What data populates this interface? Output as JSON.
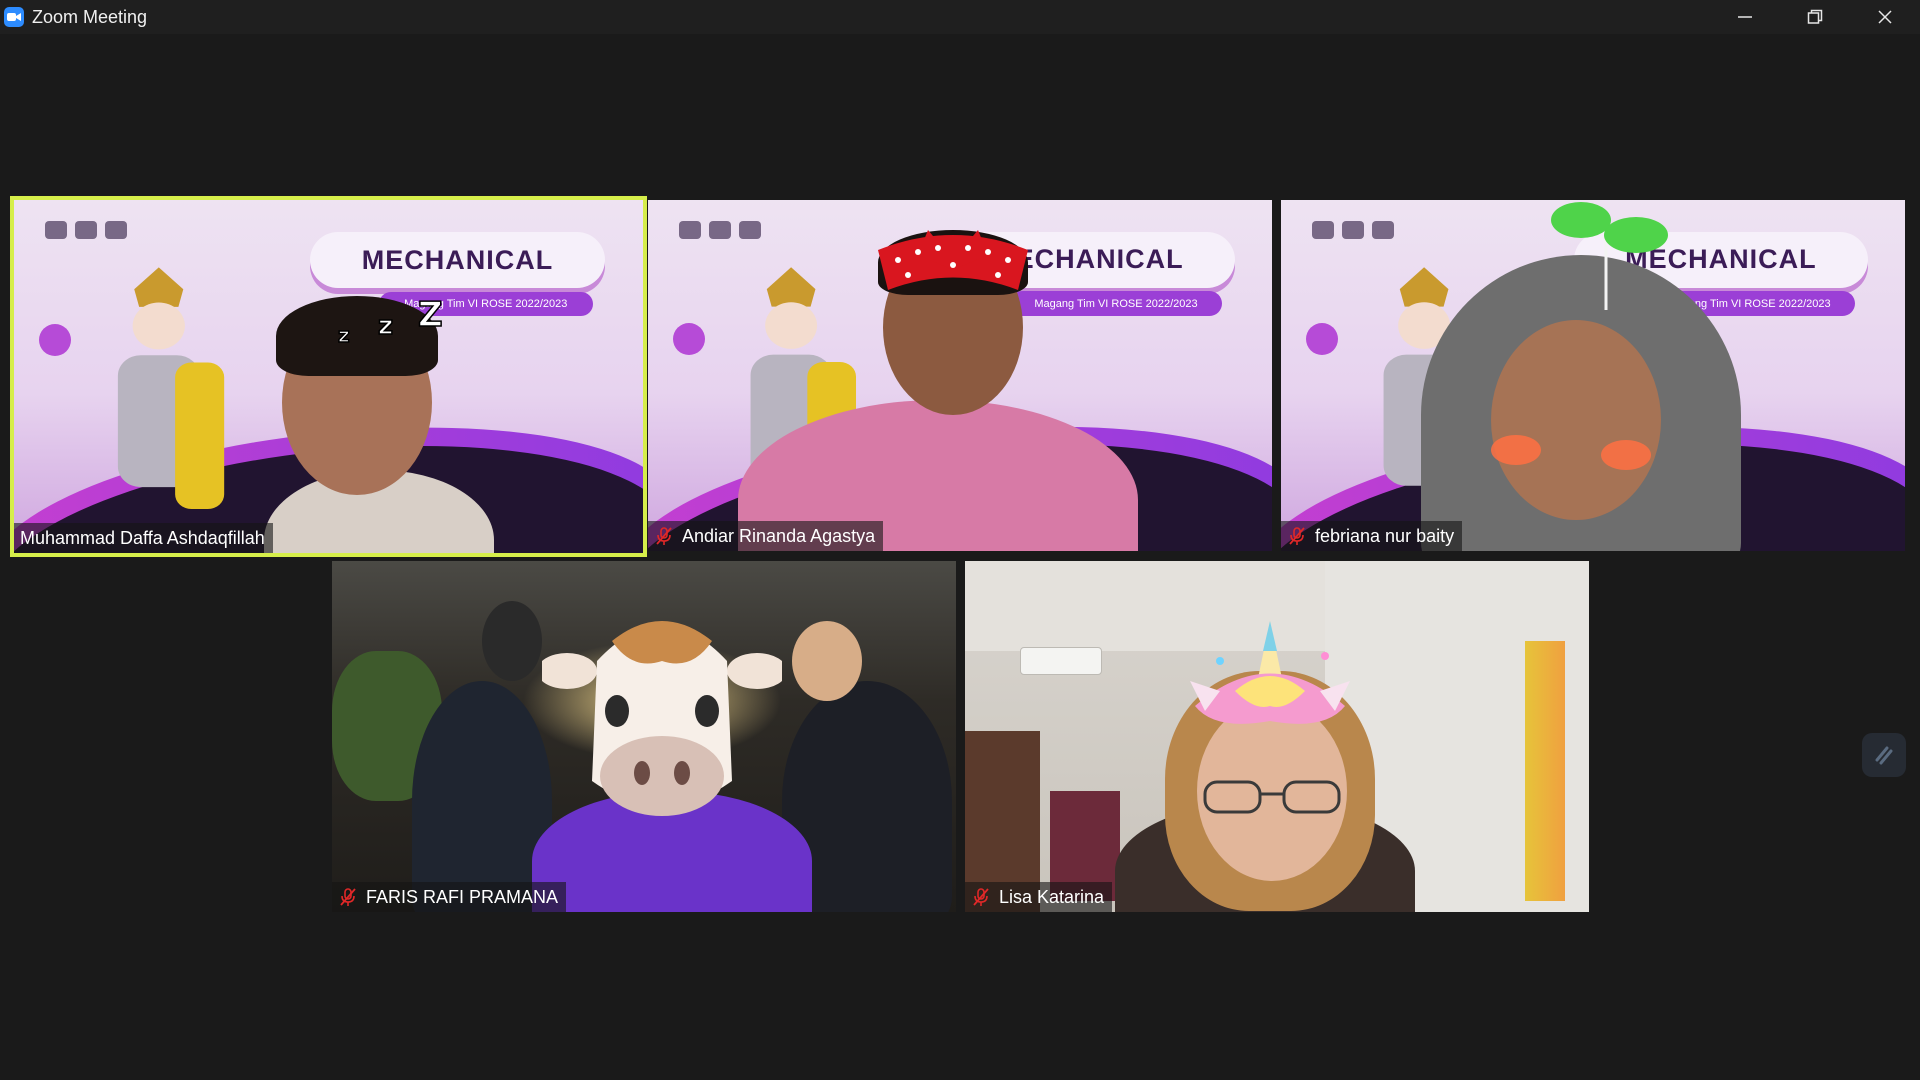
{
  "window": {
    "title": "Zoom Meeting"
  },
  "slide": {
    "heading": "MECHANICAL",
    "subheading": "Magang Tim VI ROSE 2022/2023"
  },
  "participants": [
    {
      "name": "Muhammad Daffa Ashdaqfillah",
      "muted": false,
      "active_speaker": true,
      "effect": "zzz"
    },
    {
      "name": "Andiar Rinanda Agastya",
      "muted": true,
      "active_speaker": false,
      "effect": "polka-headband"
    },
    {
      "name": "febriana nur baity",
      "muted": true,
      "active_speaker": false,
      "effect": "sprout-blush"
    },
    {
      "name": "FARIS RAFI PRAMANA",
      "muted": true,
      "active_speaker": false,
      "effect": "cow-mask"
    },
    {
      "name": "Lisa Katarina",
      "muted": true,
      "active_speaker": false,
      "effect": "unicorn"
    }
  ],
  "colors": {
    "active_border": "#d6ee4a",
    "mute_red": "#e02828",
    "zoom_blue": "#2d8cff"
  },
  "icons": {
    "app": "zoom-camera-icon",
    "minimize": "minimize-icon",
    "restore": "restore-icon",
    "close": "close-icon",
    "mic_off": "mic-off-icon",
    "floating": "whiteboard-icon"
  }
}
